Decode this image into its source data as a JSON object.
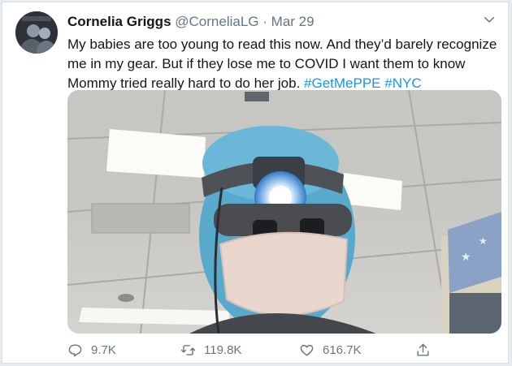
{
  "tweet": {
    "display_name": "Cornelia Griggs",
    "handle": "@CorneliaLG",
    "separator": "·",
    "date": "Mar 29",
    "text_main": "My babies are too young to read this now. And they’d barely recognize me in my gear. But if they lose me to COVID I want them to know Mommy tried really hard to do her job.",
    "hashtags": [
      "#GetMePPE",
      "#NYC"
    ]
  },
  "icons": {
    "menu": "chevron-down-icon",
    "reply": "reply-icon",
    "retweet": "retweet-icon",
    "like": "heart-icon",
    "share": "share-icon"
  },
  "actions": {
    "reply_count": "9.7K",
    "retweet_count": "119.8K",
    "like_count": "616.7K"
  },
  "colors": {
    "accent": "#1b95e0",
    "text": "#14171a",
    "secondary": "#657786"
  }
}
